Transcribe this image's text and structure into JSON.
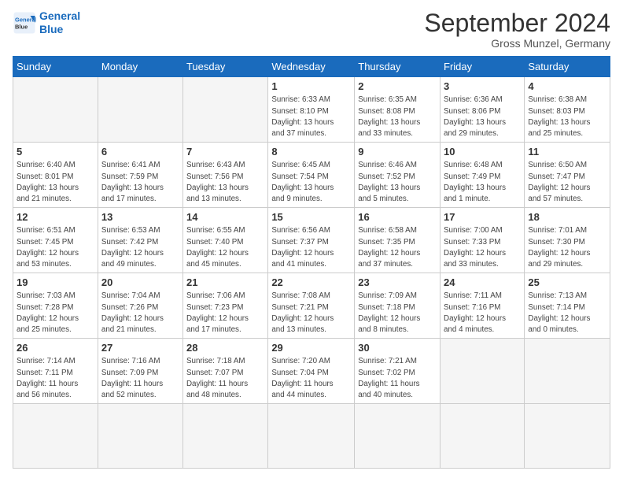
{
  "header": {
    "logo_line1": "General",
    "logo_line2": "Blue",
    "month_title": "September 2024",
    "location": "Gross Munzel, Germany"
  },
  "weekdays": [
    "Sunday",
    "Monday",
    "Tuesday",
    "Wednesday",
    "Thursday",
    "Friday",
    "Saturday"
  ],
  "days": [
    {
      "num": "",
      "info": ""
    },
    {
      "num": "",
      "info": ""
    },
    {
      "num": "",
      "info": ""
    },
    {
      "num": "1",
      "info": "Sunrise: 6:33 AM\nSunset: 8:10 PM\nDaylight: 13 hours\nand 37 minutes."
    },
    {
      "num": "2",
      "info": "Sunrise: 6:35 AM\nSunset: 8:08 PM\nDaylight: 13 hours\nand 33 minutes."
    },
    {
      "num": "3",
      "info": "Sunrise: 6:36 AM\nSunset: 8:06 PM\nDaylight: 13 hours\nand 29 minutes."
    },
    {
      "num": "4",
      "info": "Sunrise: 6:38 AM\nSunset: 8:03 PM\nDaylight: 13 hours\nand 25 minutes."
    },
    {
      "num": "5",
      "info": "Sunrise: 6:40 AM\nSunset: 8:01 PM\nDaylight: 13 hours\nand 21 minutes."
    },
    {
      "num": "6",
      "info": "Sunrise: 6:41 AM\nSunset: 7:59 PM\nDaylight: 13 hours\nand 17 minutes."
    },
    {
      "num": "7",
      "info": "Sunrise: 6:43 AM\nSunset: 7:56 PM\nDaylight: 13 hours\nand 13 minutes."
    },
    {
      "num": "8",
      "info": "Sunrise: 6:45 AM\nSunset: 7:54 PM\nDaylight: 13 hours\nand 9 minutes."
    },
    {
      "num": "9",
      "info": "Sunrise: 6:46 AM\nSunset: 7:52 PM\nDaylight: 13 hours\nand 5 minutes."
    },
    {
      "num": "10",
      "info": "Sunrise: 6:48 AM\nSunset: 7:49 PM\nDaylight: 13 hours\nand 1 minute."
    },
    {
      "num": "11",
      "info": "Sunrise: 6:50 AM\nSunset: 7:47 PM\nDaylight: 12 hours\nand 57 minutes."
    },
    {
      "num": "12",
      "info": "Sunrise: 6:51 AM\nSunset: 7:45 PM\nDaylight: 12 hours\nand 53 minutes."
    },
    {
      "num": "13",
      "info": "Sunrise: 6:53 AM\nSunset: 7:42 PM\nDaylight: 12 hours\nand 49 minutes."
    },
    {
      "num": "14",
      "info": "Sunrise: 6:55 AM\nSunset: 7:40 PM\nDaylight: 12 hours\nand 45 minutes."
    },
    {
      "num": "15",
      "info": "Sunrise: 6:56 AM\nSunset: 7:37 PM\nDaylight: 12 hours\nand 41 minutes."
    },
    {
      "num": "16",
      "info": "Sunrise: 6:58 AM\nSunset: 7:35 PM\nDaylight: 12 hours\nand 37 minutes."
    },
    {
      "num": "17",
      "info": "Sunrise: 7:00 AM\nSunset: 7:33 PM\nDaylight: 12 hours\nand 33 minutes."
    },
    {
      "num": "18",
      "info": "Sunrise: 7:01 AM\nSunset: 7:30 PM\nDaylight: 12 hours\nand 29 minutes."
    },
    {
      "num": "19",
      "info": "Sunrise: 7:03 AM\nSunset: 7:28 PM\nDaylight: 12 hours\nand 25 minutes."
    },
    {
      "num": "20",
      "info": "Sunrise: 7:04 AM\nSunset: 7:26 PM\nDaylight: 12 hours\nand 21 minutes."
    },
    {
      "num": "21",
      "info": "Sunrise: 7:06 AM\nSunset: 7:23 PM\nDaylight: 12 hours\nand 17 minutes."
    },
    {
      "num": "22",
      "info": "Sunrise: 7:08 AM\nSunset: 7:21 PM\nDaylight: 12 hours\nand 13 minutes."
    },
    {
      "num": "23",
      "info": "Sunrise: 7:09 AM\nSunset: 7:18 PM\nDaylight: 12 hours\nand 8 minutes."
    },
    {
      "num": "24",
      "info": "Sunrise: 7:11 AM\nSunset: 7:16 PM\nDaylight: 12 hours\nand 4 minutes."
    },
    {
      "num": "25",
      "info": "Sunrise: 7:13 AM\nSunset: 7:14 PM\nDaylight: 12 hours\nand 0 minutes."
    },
    {
      "num": "26",
      "info": "Sunrise: 7:14 AM\nSunset: 7:11 PM\nDaylight: 11 hours\nand 56 minutes."
    },
    {
      "num": "27",
      "info": "Sunrise: 7:16 AM\nSunset: 7:09 PM\nDaylight: 11 hours\nand 52 minutes."
    },
    {
      "num": "28",
      "info": "Sunrise: 7:18 AM\nSunset: 7:07 PM\nDaylight: 11 hours\nand 48 minutes."
    },
    {
      "num": "29",
      "info": "Sunrise: 7:20 AM\nSunset: 7:04 PM\nDaylight: 11 hours\nand 44 minutes."
    },
    {
      "num": "30",
      "info": "Sunrise: 7:21 AM\nSunset: 7:02 PM\nDaylight: 11 hours\nand 40 minutes."
    },
    {
      "num": "",
      "info": ""
    },
    {
      "num": "",
      "info": ""
    },
    {
      "num": "",
      "info": ""
    }
  ]
}
